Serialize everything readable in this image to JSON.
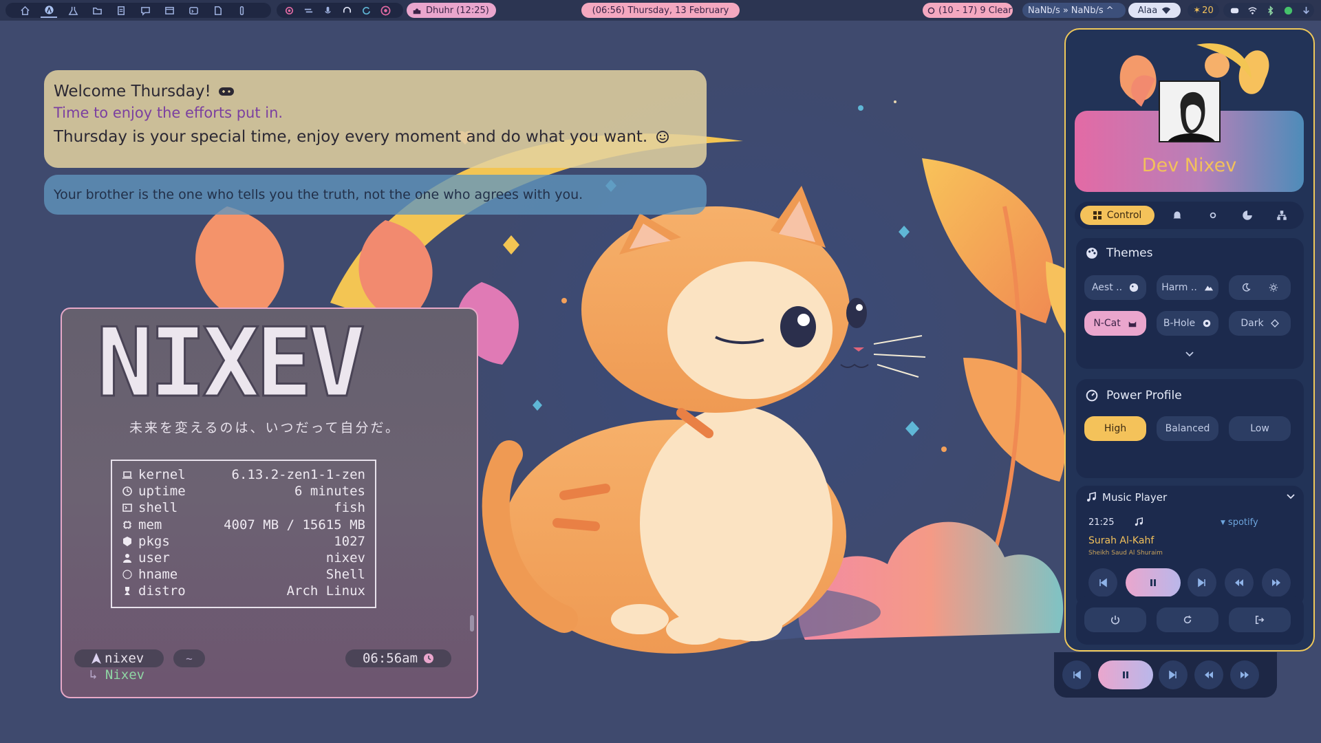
{
  "topbar": {
    "prayer": "Dhuhr (12:25)",
    "datetime": "(06:56) Thursday, 13 February",
    "weather": "(10 - 17) 9 Clear",
    "net_down": "NaNb/s",
    "net_up": "NaNb/s",
    "wifi_name": "Alaa",
    "notifications": "20",
    "icons_left": [
      "home-icon",
      "arch-icon",
      "flask-icon",
      "folder-icon",
      "files-icon",
      "chat-icon",
      "window-icon",
      "terminal-icon",
      "document-icon",
      "pen-icon"
    ],
    "icons_mid": [
      "record-icon",
      "wave-icon",
      "mic-icon",
      "headphones-icon",
      "sync-icon",
      "spotify-icon"
    ],
    "icons_right": [
      "discord-icon",
      "wifi-icon",
      "bluetooth-icon",
      "power-dot-icon",
      "download-icon"
    ]
  },
  "welcome": {
    "title": "Welcome Thursday!",
    "subtitle": "Time to enjoy the efforts put in.",
    "message": "Thursday is your special time, enjoy every moment and do what you want."
  },
  "quote": "Your brother is the one who tells you the truth, not the one who agrees with you.",
  "terminal": {
    "logo": "NIXEV",
    "tagline": "未来を変えるのは、いつだって自分だ。",
    "fetch": [
      {
        "icon": "laptop-icon",
        "key": "kernel",
        "value": "6.13.2-zen1-1-zen"
      },
      {
        "icon": "clock-icon",
        "key": "uptime",
        "value": "6 minutes"
      },
      {
        "icon": "shell-icon",
        "key": "shell",
        "value": "fish"
      },
      {
        "icon": "chip-icon",
        "key": "mem",
        "value": "4007 MB / 15615 MB"
      },
      {
        "icon": "package-icon",
        "key": "pkgs",
        "value": "1027"
      },
      {
        "icon": "user-icon",
        "key": "user",
        "value": "nixev"
      },
      {
        "icon": "circle-icon",
        "key": "hname",
        "value": "Shell"
      },
      {
        "icon": "distro-icon",
        "key": "distro",
        "value": "Arch Linux"
      }
    ],
    "prompt_user": "nixev",
    "prompt_dir": "~",
    "prompt_time": "06:56am",
    "prompt_host": "Nixev"
  },
  "sidebar": {
    "profile_name": "Dev Nixev",
    "tabs": {
      "control": "Control"
    },
    "themes": {
      "title": "Themes",
      "items": [
        {
          "label": "Aest ..",
          "icon": "palette-icon"
        },
        {
          "label": "Harm ..",
          "icon": "mountain-icon"
        },
        {
          "label": "",
          "icon": "moon-icon"
        },
        {
          "label": "",
          "icon": "sun-icon"
        },
        {
          "label": "N-Cat",
          "icon": "cat-icon"
        },
        {
          "label": "B-Hole",
          "icon": "blackhole-icon"
        },
        {
          "label": "Dark",
          "icon": "diamond-icon"
        }
      ]
    },
    "power": {
      "title": "Power Profile",
      "options": [
        "High",
        "Balanced",
        "Low"
      ],
      "selected": "High"
    },
    "music": {
      "title": "Music Player",
      "time": "21:25",
      "source": "spotify",
      "track": "Surah Al-Kahf",
      "artist": "Sheikh Saud Al Shuraim"
    }
  },
  "colors": {
    "accent": "#f4c25a",
    "panel": "#1c2a4d",
    "button": "#2c3d63",
    "active_theme": "#eaa6cd",
    "profile_name": "#f2c15b"
  }
}
